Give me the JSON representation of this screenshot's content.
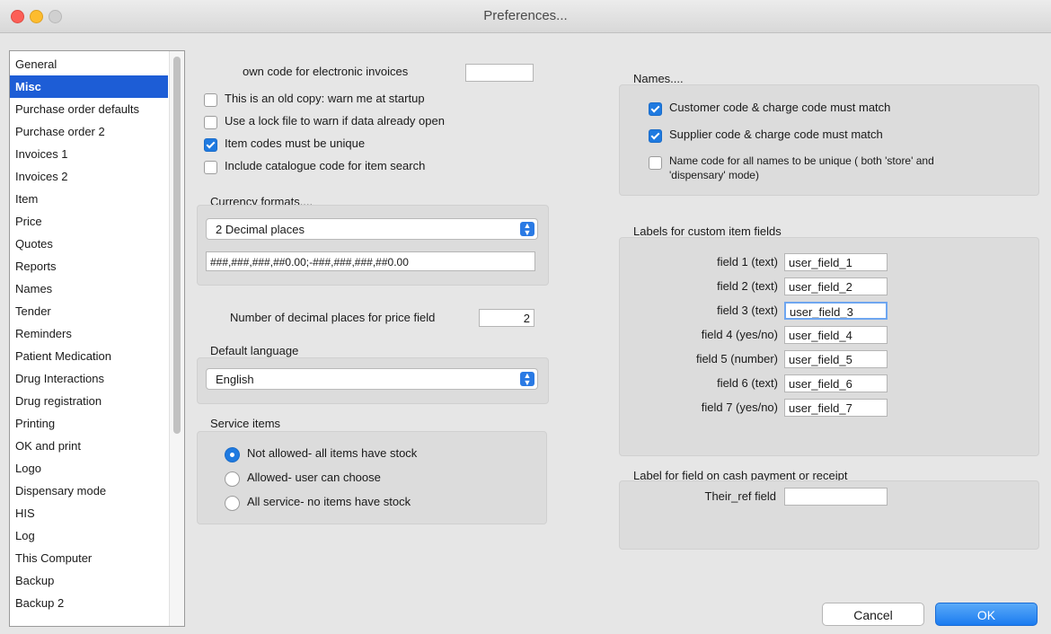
{
  "window": {
    "title": "Preferences..."
  },
  "sidebar": {
    "items": [
      "General",
      "Misc",
      "Purchase order defaults",
      "Purchase order 2",
      "Invoices 1",
      "Invoices 2",
      "Item",
      "Price",
      "Quotes",
      "Reports",
      "Names",
      "Tender",
      "Reminders",
      "Patient Medication",
      "Drug Interactions",
      "Drug registration",
      "Printing",
      "OK and print",
      "Logo",
      "Dispensary mode",
      "HIS",
      "Log",
      "This Computer",
      "Backup",
      "Backup 2"
    ],
    "selected": "Misc"
  },
  "misc": {
    "own_code_label": "own code for electronic invoices",
    "own_code_value": "",
    "checkboxes": [
      {
        "label": "This is an old copy: warn me at startup",
        "checked": false
      },
      {
        "label": "Use a lock file to warn if data already open",
        "checked": false
      },
      {
        "label": "Item codes must be unique",
        "checked": true
      },
      {
        "label": "Include catalogue code for item search",
        "checked": false
      }
    ],
    "currency_formats_label": "Currency formats....",
    "currency_select_value": "2 Decimal places",
    "currency_format_string": "###,###,###,##0.00;-###,###,###,##0.00",
    "decimal_places_label": "Number of decimal places for price field",
    "decimal_places_value": "2",
    "default_language_label": "Default language",
    "default_language_value": "English",
    "service_items_label": "Service items",
    "service_options": [
      {
        "label": "Not allowed- all items have stock",
        "selected": true
      },
      {
        "label": "Allowed- user can choose",
        "selected": false
      },
      {
        "label": "All service- no items have stock",
        "selected": false
      }
    ]
  },
  "names": {
    "label": "Names....",
    "checkboxes": [
      {
        "label": "Customer code & charge code must match",
        "checked": true
      },
      {
        "label": "Supplier code & charge code must match",
        "checked": true
      },
      {
        "label": "Name code for all names to be unique ( both 'store' and",
        "label2": "'dispensary' mode)",
        "checked": false
      }
    ]
  },
  "custom_fields": {
    "label": "Labels for custom item fields",
    "fields": [
      {
        "label": "field 1 (text)",
        "value": "user_field_1"
      },
      {
        "label": "field 2 (text)",
        "value": "user_field_2"
      },
      {
        "label": "field 3 (text)",
        "value": "user_field_3"
      },
      {
        "label": "field 4 (yes/no)",
        "value": "user_field_4"
      },
      {
        "label": "field 5 (number)",
        "value": "user_field_5"
      },
      {
        "label": "field 6 (text)",
        "value": "user_field_6"
      },
      {
        "label": "field 7 (yes/no)",
        "value": "user_field_7"
      }
    ]
  },
  "cash_payment": {
    "label": "Label for field on cash payment or receipt",
    "their_ref_label": "Their_ref field",
    "their_ref_value": ""
  },
  "buttons": {
    "cancel": "Cancel",
    "ok": "OK"
  },
  "colors": {
    "accent": "#1f7ae0",
    "selection": "#1d5dd6"
  }
}
